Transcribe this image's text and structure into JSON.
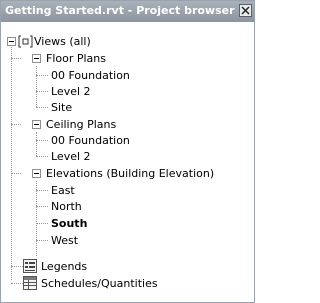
{
  "window": {
    "title": "Getting Started.rvt - Project browser",
    "close_symbol": "✕"
  },
  "tree": {
    "views": {
      "label": "Views (all)",
      "icon": "views-icon"
    },
    "floor_plans": {
      "label": "Floor Plans",
      "items": [
        "00 Foundation",
        "Level 2",
        "Site"
      ]
    },
    "ceiling_plans": {
      "label": "Ceiling Plans",
      "items": [
        "00 Foundation",
        "Level 2"
      ]
    },
    "elevations": {
      "label": "Elevations (Building Elevation)",
      "items": [
        "East",
        "North",
        "South",
        "West"
      ],
      "selected": "South"
    },
    "legends": {
      "label": "Legends",
      "icon": "legend-icon"
    },
    "schedules": {
      "label": "Schedules/Quantities",
      "icon": "schedule-icon"
    }
  }
}
